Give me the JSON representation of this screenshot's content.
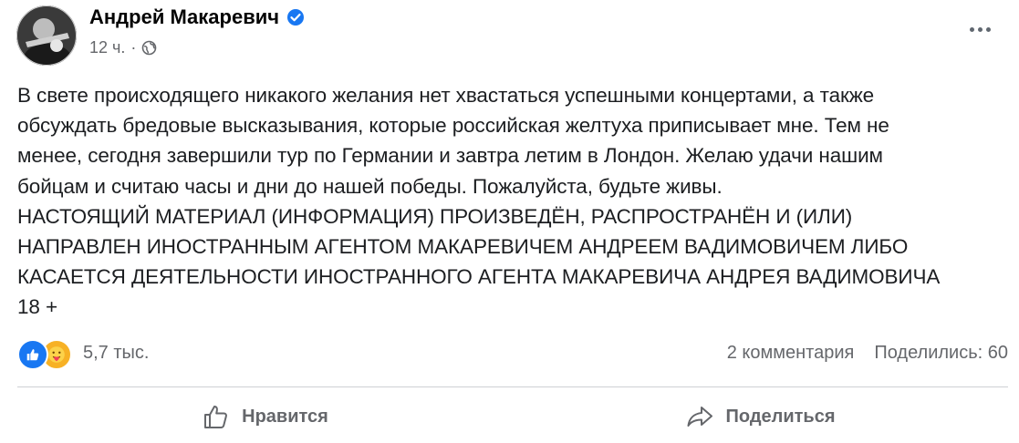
{
  "post": {
    "author": "Андрей Макаревич",
    "time": "12 ч.",
    "separator": "·",
    "lines": [
      "В свете происходящего никакого желания нет хвастаться успешными концертами, а также",
      "обсуждать бредовые высказывания, которые российская желтуха приписывает мне. Тем не",
      "менее, сегодня завершили тур по Германии и завтра летим в Лондон. Желаю удачи нашим",
      "бойцам и считаю часы и дни до нашей победы. Пожалуйста, будьте живы.",
      "НАСТОЯЩИЙ МАТЕРИАЛ (ИНФОРМАЦИЯ) ПРОИЗВЕДЁН, РАСПРОСТРАНЁН И (ИЛИ)",
      "НАПРАВЛЕН ИНОСТРАННЫМ АГЕНТОМ МАКАРЕВИЧЕМ АНДРЕЕМ ВАДИМОВИЧЕМ ЛИБО",
      "КАСАЕТСЯ ДЕЯТЕЛЬНОСТИ ИНОСТРАННОГО АГЕНТА МАКАРЕВИЧА АНДРЕЯ ВАДИМОВИЧА",
      "18 +"
    ]
  },
  "reactions": {
    "count": "5,7 тыс.",
    "icons": [
      "like-icon",
      "care-icon"
    ]
  },
  "stats": {
    "comments": "2 комментария",
    "shares": "Поделились: 60"
  },
  "actions": {
    "like": "Нравится",
    "share": "Поделиться"
  },
  "colors": {
    "like_blue": "#1877f2",
    "care_yellow": "#f7b125",
    "secondary_text": "#65676b"
  }
}
